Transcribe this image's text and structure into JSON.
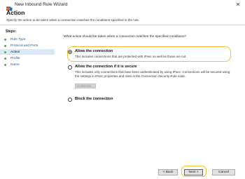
{
  "window": {
    "title": "New Inbound Rule Wizard",
    "close_glyph": "✕"
  },
  "header": {
    "heading": "Action",
    "subheading": "Specify the action to be taken when a connection matches the conditions specified in the rule."
  },
  "steps": {
    "title": "Steps:",
    "items": [
      {
        "label": "Rule Type",
        "current": false
      },
      {
        "label": "Protocol and Ports",
        "current": false
      },
      {
        "label": "Action",
        "current": true
      },
      {
        "label": "Profile",
        "current": false
      },
      {
        "label": "Name",
        "current": false
      }
    ]
  },
  "main": {
    "question": "What action should be taken when a connection matches the specified conditions?",
    "options": [
      {
        "label": "Allow the connection",
        "description": "This includes connections that are protected with IPsec as well as those are not.",
        "selected": true
      },
      {
        "label": "Allow the connection if it is secure",
        "description": "This includes only connections that have been authenticated by using IPsec.  Connections will be secured using the settings in IPsec properties and rules in the Connection Security Rule node.",
        "selected": false
      },
      {
        "label": "Block the connection",
        "description": "",
        "selected": false
      }
    ],
    "customize_label": "Customize..."
  },
  "footer": {
    "back_label": "< Back",
    "next_label": "Next >",
    "cancel_label": "Cancel"
  },
  "colors": {
    "highlight": "#f2c12e",
    "link": "#0f5ca8",
    "current_step_bg": "#dbe7f5",
    "step_bullet": "#5aa64a"
  },
  "icons": {
    "app": "firewall-shield-icon"
  }
}
